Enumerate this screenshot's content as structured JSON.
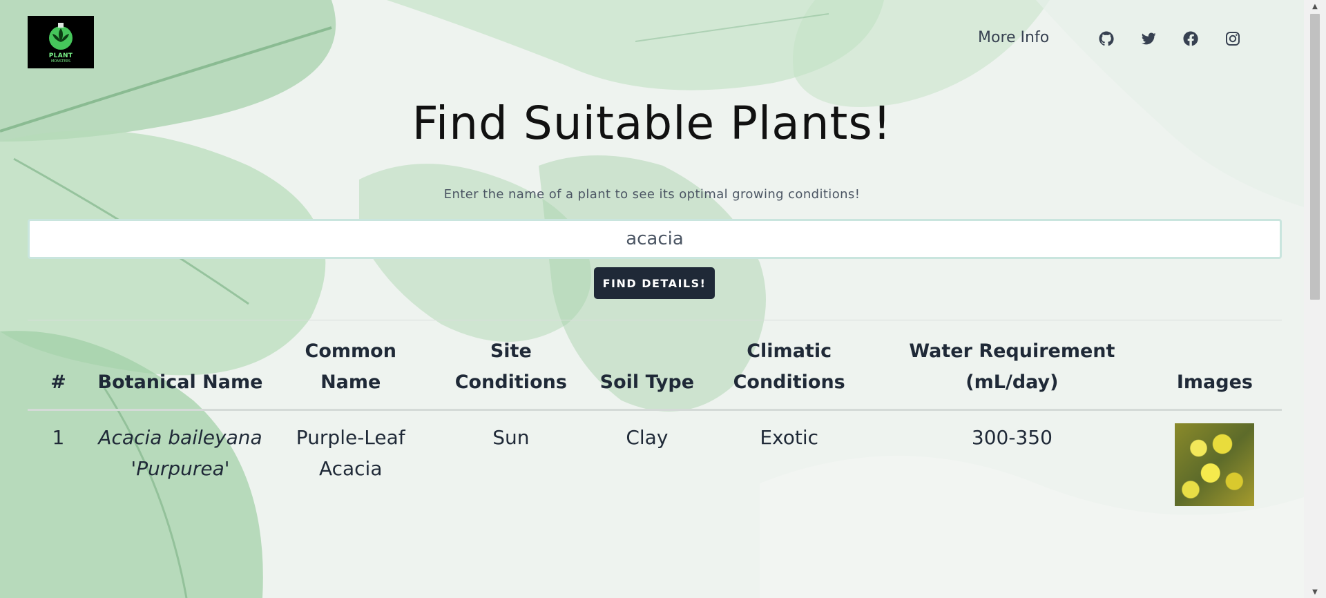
{
  "header": {
    "logo": {
      "text": "PLANT",
      "subtext": "MONSTERS",
      "accent": "#7bf58a"
    },
    "more_info_label": "More Info",
    "social_icons": [
      "github-icon",
      "twitter-icon",
      "facebook-icon",
      "instagram-icon"
    ]
  },
  "hero": {
    "title": "Find Suitable Plants!",
    "subtitle": "Enter the name of a plant to see its optimal growing conditions!",
    "search_value": "acacia",
    "button_label": "FIND DETAILS!"
  },
  "table": {
    "columns": [
      "#",
      "Botanical Name",
      "Common Name",
      "Site Conditions",
      "Soil Type",
      "Climatic Conditions",
      "Water Requirement (mL/day)",
      "Images"
    ],
    "rows": [
      {
        "index": "1",
        "botanical_name": "Acacia baileyana 'Purpurea'",
        "common_name": "Purple-Leaf Acacia",
        "site_conditions": "Sun",
        "soil_type": "Clay",
        "climatic_conditions": "Exotic",
        "water_requirement": "300-350"
      }
    ]
  },
  "colors": {
    "button_bg": "#1f2937",
    "background": "#eef3ef",
    "leaf_green": "#7fc08b"
  }
}
